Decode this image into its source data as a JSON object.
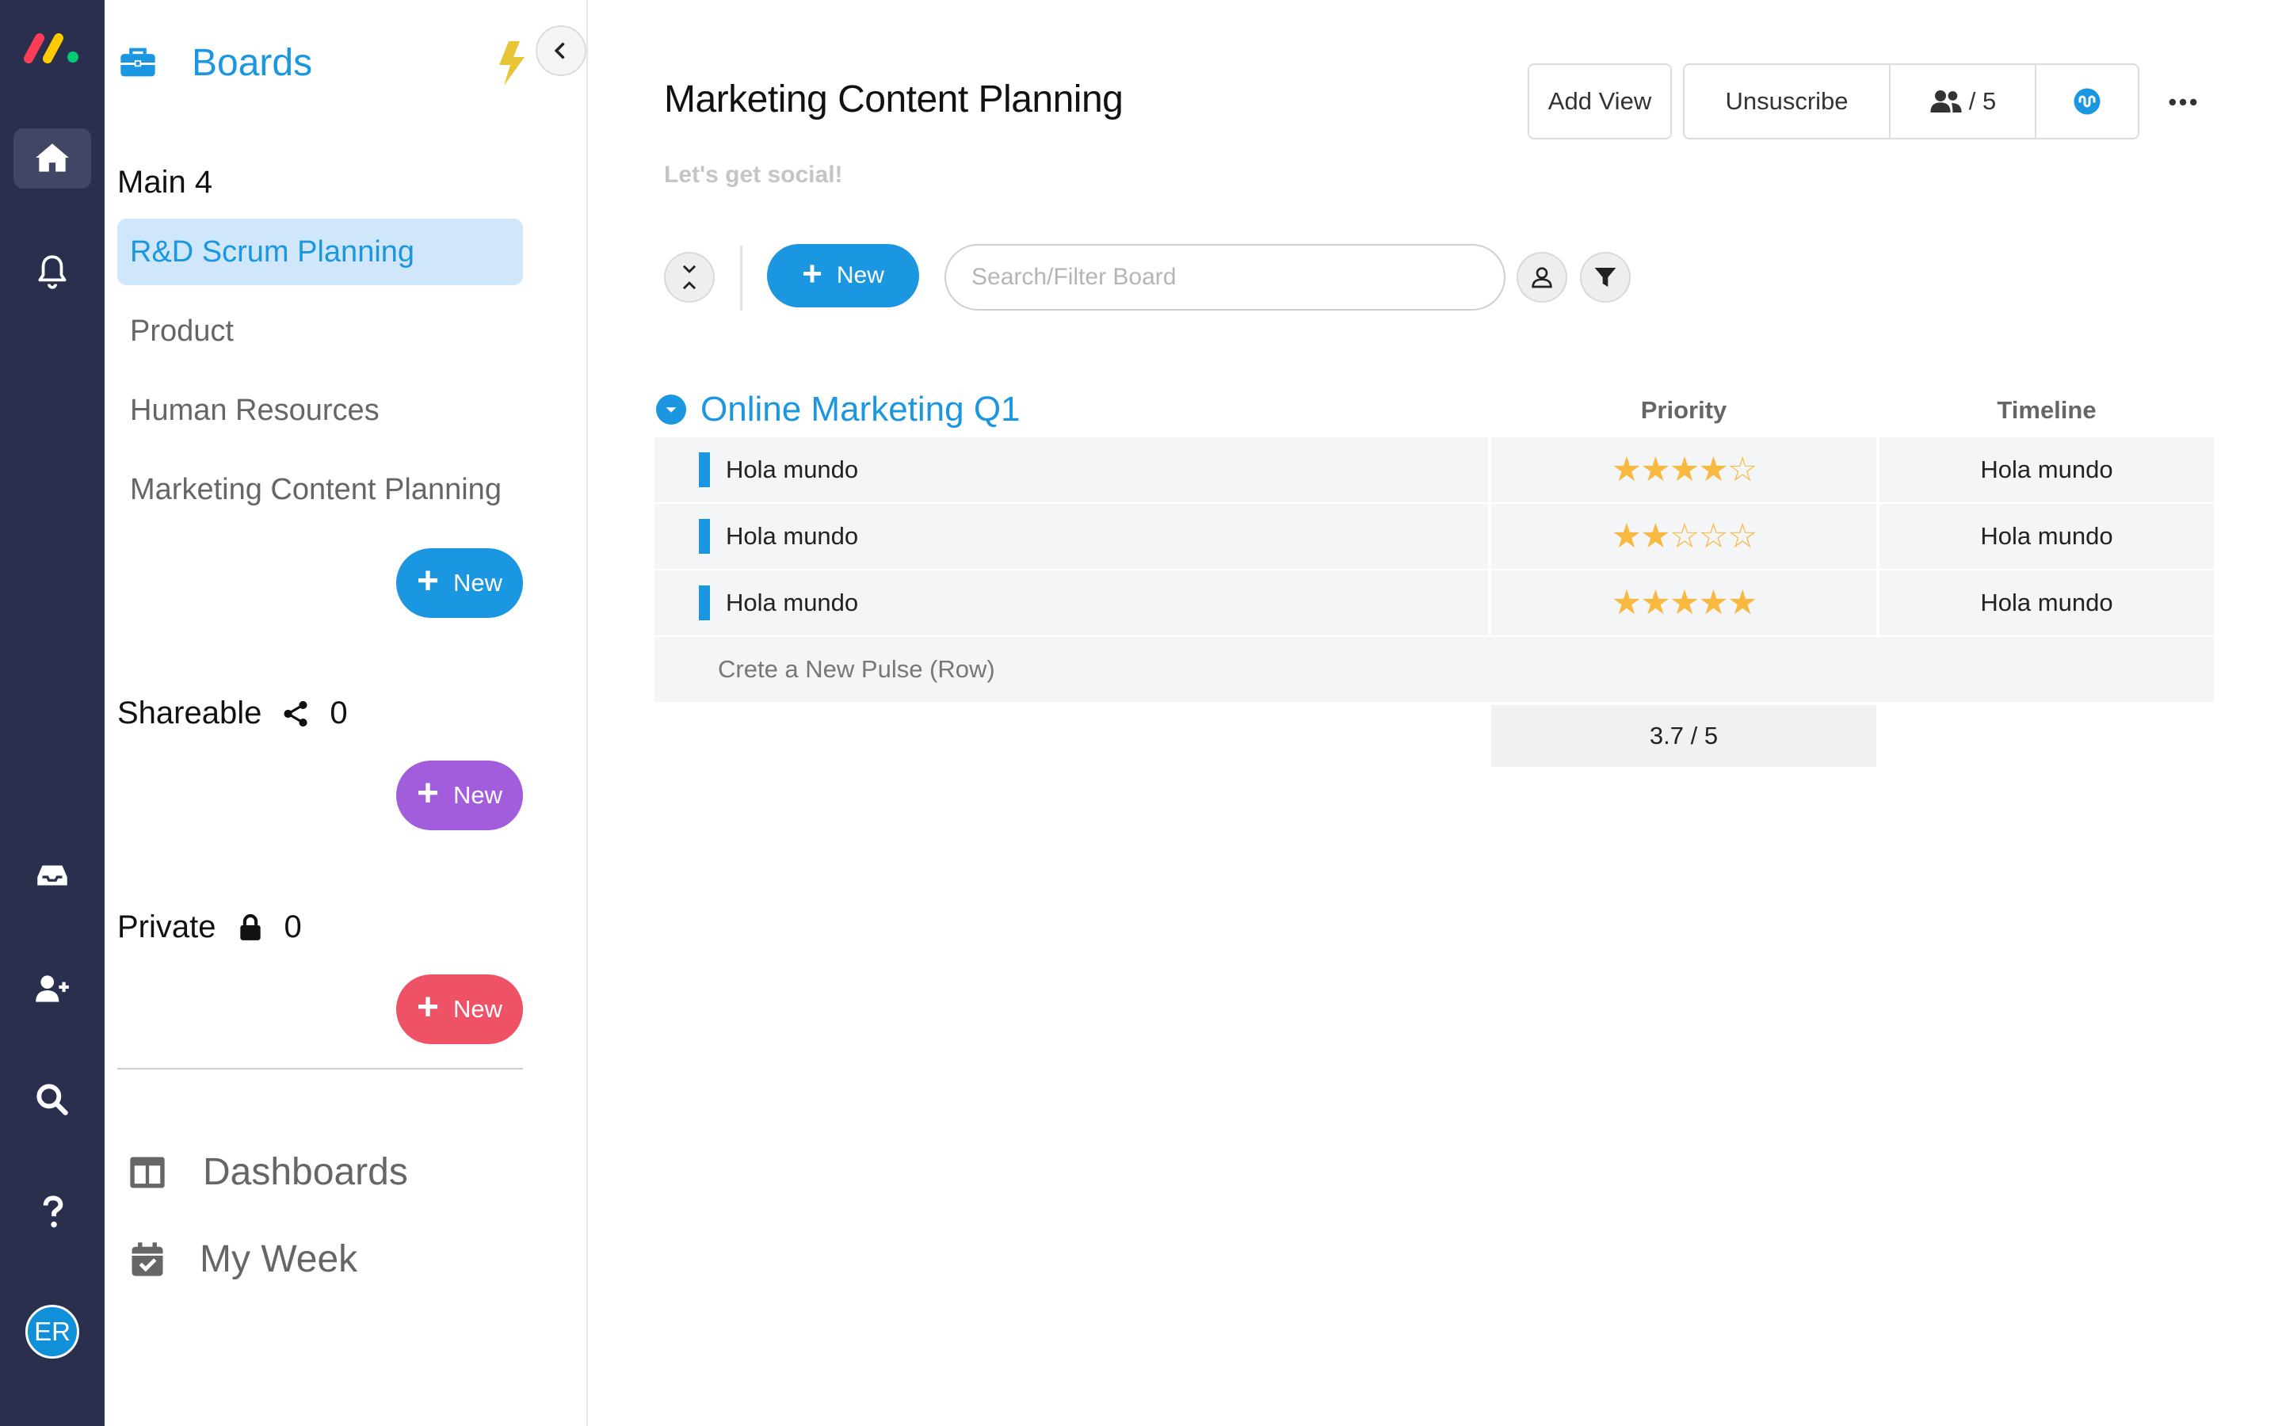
{
  "rail": {
    "avatar_initials": "ER",
    "active_item": "home",
    "icons": [
      "monday-logo",
      "home-icon",
      "bell-icon",
      "inbox-icon",
      "invite-user-icon",
      "search-icon",
      "help-icon"
    ]
  },
  "panel": {
    "title": "Boards",
    "sections": {
      "main": {
        "label": "Main",
        "count": "4"
      },
      "shareable": {
        "label": "Shareable",
        "count": "0"
      },
      "private": {
        "label": "Private",
        "count": "0"
      }
    },
    "boards": [
      {
        "label": "R&D Scrum Planning",
        "selected": true
      },
      {
        "label": "Product"
      },
      {
        "label": "Human Resources"
      },
      {
        "label": "Marketing Content Planning"
      }
    ],
    "new_label": "New",
    "dashboards_label": "Dashboards",
    "my_week_label": "My Week",
    "colors": {
      "main_new": "#1a97e0",
      "shareable_new": "#a25ddc",
      "private_new": "#ef5166"
    }
  },
  "board": {
    "title": "Marketing Content Planning",
    "description": "Let's get social!",
    "add_view_label": "Add View",
    "unsubscribe_label": "Unsuscribe",
    "members_label": "/ 5",
    "toolbar": {
      "new_label": "New",
      "search_placeholder": "Search/Filter Board"
    },
    "group": {
      "name": "Online Marketing Q1",
      "color": "#1a97e0",
      "columns": {
        "priority": "Priority",
        "timeline": "Timeline"
      },
      "rows": [
        {
          "name": "Hola mundo",
          "priority": 4,
          "priority_stars": "★★★★☆",
          "timeline": "Hola mundo"
        },
        {
          "name": "Hola mundo",
          "priority": 2,
          "priority_stars": "★★☆☆☆",
          "timeline": "Hola mundo"
        },
        {
          "name": "Hola mundo",
          "priority": 5,
          "priority_stars": "★★★★★",
          "timeline": "Hola mundo"
        }
      ],
      "add_row_label": "Crete a New Pulse (Row)",
      "priority_summary": "3.7 / 5"
    }
  }
}
